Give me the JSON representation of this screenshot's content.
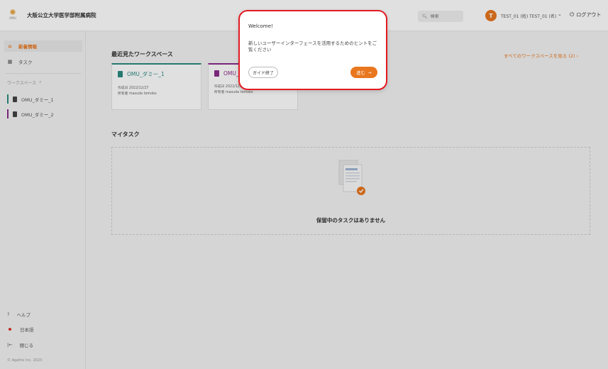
{
  "header": {
    "org_name": "大阪公立大学医学部附属病院",
    "search_placeholder": "検索",
    "avatar_initial": "T",
    "user_name": "TEST_01 (姓) TEST_01 (名)",
    "logout_label": "ログアウト"
  },
  "sidebar": {
    "items": [
      {
        "label": "新着情報",
        "icon": "home-icon"
      },
      {
        "label": "タスク",
        "icon": "calendar-icon"
      }
    ],
    "workspace_label": "ワークスペース",
    "workspaces": [
      {
        "label": "OMU_ダミー_1",
        "color": "#2c8a80"
      },
      {
        "label": "OMU_ダミー_2",
        "color": "#8a2c8a"
      }
    ],
    "bottom": [
      {
        "label": "ヘルプ"
      },
      {
        "label": "日本語"
      },
      {
        "label": "閉じる"
      }
    ],
    "copyright": "© Agathe Inc. 2023"
  },
  "main": {
    "recent_title": "最近見たワークスペース",
    "see_all": "すべてのワークスペースを見る (2) ›",
    "cards": [
      {
        "name": "OMU_ダミー_1",
        "created": "作成日 2022/12/27",
        "owner": "所有者 masuda tomoko",
        "color": "#2c8a80"
      },
      {
        "name": "OMU_",
        "created": "作成日 2022/12/27",
        "owner": "所有者 masuda tomoko",
        "color": "#8a2c8a"
      }
    ],
    "mytask_title": "マイタスク",
    "empty_text": "保留中のタスクはありません"
  },
  "popover": {
    "title": "Welcome!",
    "body": "新しいユーザーインターフェースを活用するためのヒントをご覧ください",
    "end_label": "ガイド終了",
    "next_label": "進む"
  },
  "colors": {
    "accent": "#e8771f",
    "highlight_border": "#e21b22"
  }
}
